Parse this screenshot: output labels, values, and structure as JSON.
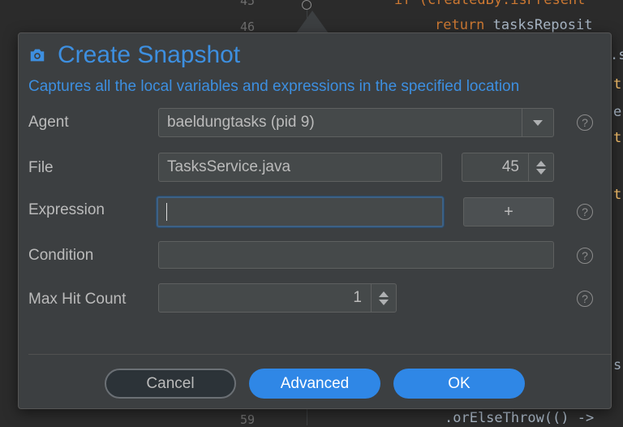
{
  "editor": {
    "line_numbers": [
      "45",
      "46",
      "59"
    ],
    "code_top": "if (createdBy.isPresent",
    "code_return_kw": "return",
    "code_return_rest": " tasksReposit",
    "code_fragments": [
      ".s",
      "t",
      "e",
      "t",
      "t",
      "s"
    ],
    "code_bottom": ".orElseThrow(() ->"
  },
  "dialog": {
    "icon": "camera-icon",
    "title": "Create Snapshot",
    "subtitle": "Captures all the local variables and expressions in the specified location",
    "agent_label": "Agent",
    "agent_value": "baeldungtasks (pid 9)",
    "file_label": "File",
    "file_value": "TasksService.java",
    "line_value": "45",
    "expression_label": "Expression",
    "expression_value": "",
    "add_label": "+",
    "condition_label": "Condition",
    "condition_value": "",
    "max_hit_label": "Max Hit Count",
    "max_hit_value": "1",
    "help_glyph": "?",
    "cancel_label": "Cancel",
    "advanced_label": "Advanced",
    "ok_label": "OK"
  },
  "colors": {
    "accent": "#3d8fe0",
    "primary_button": "#2f87e6",
    "dialog_bg": "#3c3f41",
    "editor_bg": "#2b2b2b"
  }
}
